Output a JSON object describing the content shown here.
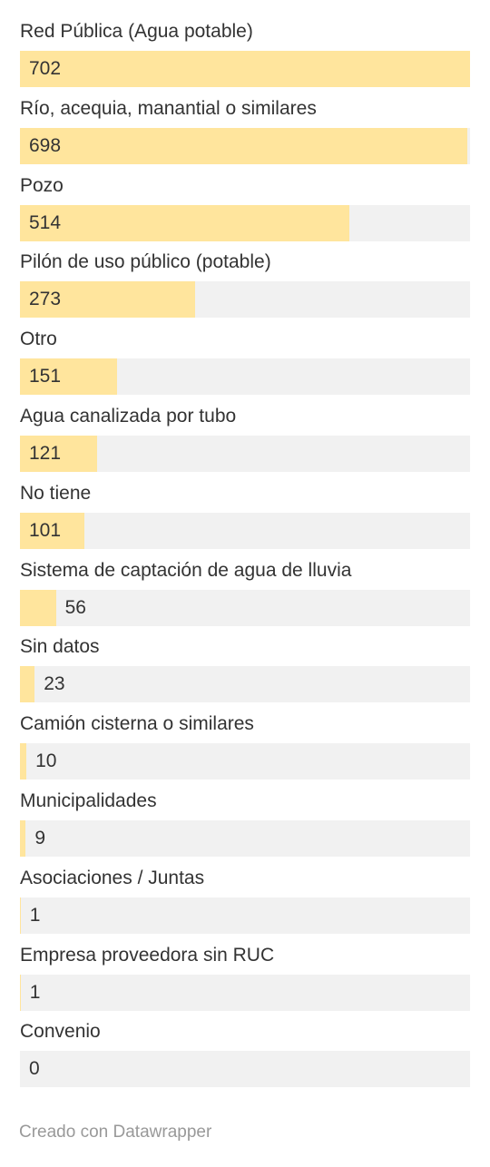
{
  "chart_data": {
    "type": "bar",
    "orientation": "horizontal",
    "categories": [
      "Red Pública (Agua potable)",
      "Río, acequia, manantial o similares",
      "Pozo",
      "Pilón de uso público (potable)",
      "Otro",
      "Agua canalizada por tubo",
      "No tiene",
      "Sistema de captación de agua de lluvia",
      "Sin datos",
      "Camión cisterna o similares",
      "Municipalidades",
      "Asociaciones / Juntas",
      "Empresa proveedora sin RUC",
      "Convenio"
    ],
    "values": [
      702,
      698,
      514,
      273,
      151,
      121,
      101,
      56,
      23,
      10,
      9,
      1,
      1,
      0
    ],
    "xlim": [
      0,
      702
    ],
    "grid": false,
    "bar_color": "#ffe59d",
    "track_color": "#f1f1f1"
  },
  "footer": {
    "credit": "Creado con Datawrapper"
  }
}
